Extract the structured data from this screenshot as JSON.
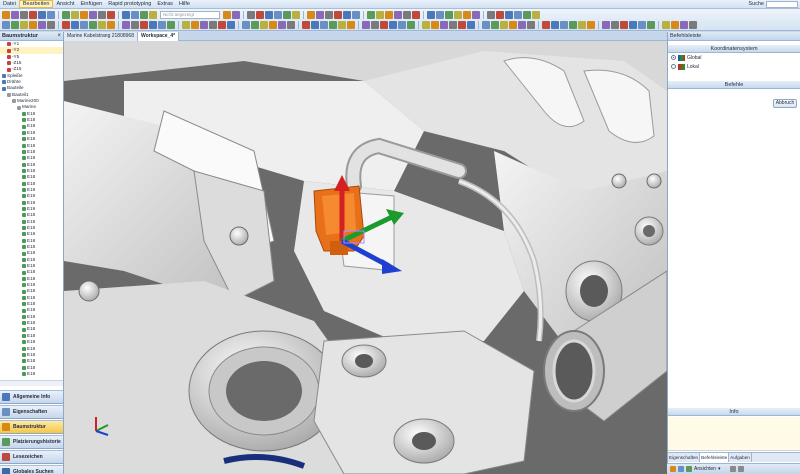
{
  "menu": {
    "items": [
      "Datei",
      "Bearbeiten",
      "Ansicht",
      "Einfügen",
      "Rapid prototyping",
      "Extras",
      "Hilfe"
    ],
    "active_index": 1,
    "search_label": "Suche"
  },
  "toolbar": {
    "search_placeholder": "Nicht angezeigt"
  },
  "left_panel": {
    "title": "Baumstruktur",
    "close": "×",
    "tree": [
      {
        "indent": 1,
        "label": "-Y1",
        "icon": "red"
      },
      {
        "indent": 1,
        "label": "-Y2",
        "icon": "red",
        "selected": true
      },
      {
        "indent": 1,
        "label": "-Y5",
        "icon": "red"
      },
      {
        "indent": 1,
        "label": "-Z15",
        "icon": "red"
      },
      {
        "indent": 1,
        "label": "-Z15",
        "icon": "red"
      },
      {
        "indent": 0,
        "label": "Spleiße",
        "icon": "blue"
      },
      {
        "indent": 0,
        "label": "Drähte",
        "icon": "blue"
      },
      {
        "indent": 0,
        "label": "Bauteile",
        "icon": "blue"
      },
      {
        "indent": 1,
        "label": "Bauteil1",
        "icon": "gray"
      },
      {
        "indent": 2,
        "label": "Marine200",
        "icon": "gray"
      },
      {
        "indent": 3,
        "label": "Marine",
        "icon": "gray"
      },
      {
        "indent": 4,
        "label": "E18",
        "icon": "green"
      },
      {
        "indent": 4,
        "label": "E18",
        "icon": "green"
      },
      {
        "indent": 4,
        "label": "E18",
        "icon": "green"
      },
      {
        "indent": 4,
        "label": "E18",
        "icon": "green"
      },
      {
        "indent": 4,
        "label": "E18",
        "icon": "green"
      },
      {
        "indent": 4,
        "label": "E18",
        "icon": "green"
      },
      {
        "indent": 4,
        "label": "E18",
        "icon": "green"
      },
      {
        "indent": 4,
        "label": "E18",
        "icon": "green"
      },
      {
        "indent": 4,
        "label": "E18",
        "icon": "green"
      },
      {
        "indent": 4,
        "label": "E18",
        "icon": "green"
      },
      {
        "indent": 4,
        "label": "E18",
        "icon": "green"
      },
      {
        "indent": 4,
        "label": "E18",
        "icon": "green"
      },
      {
        "indent": 4,
        "label": "E19",
        "icon": "green"
      },
      {
        "indent": 4,
        "label": "E19",
        "icon": "green"
      },
      {
        "indent": 4,
        "label": "E19",
        "icon": "green"
      },
      {
        "indent": 4,
        "label": "E19",
        "icon": "green"
      },
      {
        "indent": 4,
        "label": "E18",
        "icon": "green"
      },
      {
        "indent": 4,
        "label": "E18",
        "icon": "green"
      },
      {
        "indent": 4,
        "label": "E18",
        "icon": "green"
      },
      {
        "indent": 4,
        "label": "E18",
        "icon": "green"
      },
      {
        "indent": 4,
        "label": "E18",
        "icon": "green"
      },
      {
        "indent": 4,
        "label": "E18",
        "icon": "green"
      },
      {
        "indent": 4,
        "label": "E18",
        "icon": "green"
      },
      {
        "indent": 4,
        "label": "E18",
        "icon": "green"
      },
      {
        "indent": 4,
        "label": "E18",
        "icon": "green"
      },
      {
        "indent": 4,
        "label": "E18",
        "icon": "green"
      },
      {
        "indent": 4,
        "label": "E18",
        "icon": "green"
      },
      {
        "indent": 4,
        "label": "E18",
        "icon": "green"
      },
      {
        "indent": 4,
        "label": "E18",
        "icon": "green"
      },
      {
        "indent": 4,
        "label": "E18",
        "icon": "green"
      },
      {
        "indent": 4,
        "label": "E18",
        "icon": "green"
      },
      {
        "indent": 4,
        "label": "E18",
        "icon": "green"
      },
      {
        "indent": 4,
        "label": "E18",
        "icon": "green"
      },
      {
        "indent": 4,
        "label": "E18",
        "icon": "green"
      },
      {
        "indent": 4,
        "label": "E18",
        "icon": "green"
      },
      {
        "indent": 4,
        "label": "E18",
        "icon": "green"
      },
      {
        "indent": 4,
        "label": "E18",
        "icon": "green"
      },
      {
        "indent": 4,
        "label": "E18",
        "icon": "green"
      },
      {
        "indent": 4,
        "label": "E18",
        "icon": "green"
      },
      {
        "indent": 4,
        "label": "E18",
        "icon": "green"
      },
      {
        "indent": 4,
        "label": "E18",
        "icon": "green"
      },
      {
        "indent": 4,
        "label": "E18",
        "icon": "green"
      }
    ],
    "nav": [
      {
        "label": "Allgemeine Info",
        "icon_color": "#4a78b8",
        "active": false
      },
      {
        "label": "Eigenschaften",
        "icon_color": "#6a8fc2",
        "active": false
      },
      {
        "label": "Baumstruktur",
        "icon_color": "#d88a18",
        "active": true
      },
      {
        "label": "Platzierungshistorie",
        "icon_color": "#5a9a5a",
        "active": false
      },
      {
        "label": "Lesezeichen",
        "icon_color": "#c04a3a",
        "active": false
      },
      {
        "label": "Globales Suchen",
        "icon_color": "#3a6aa8",
        "active": false
      }
    ]
  },
  "doc_tabs": [
    {
      "label": "Marine Kabelstrang 21808968",
      "active": false
    },
    {
      "label": "Workspace_4*",
      "active": true
    }
  ],
  "right_panel": {
    "title": "Befehlsleiste",
    "coord_header": "Koordinatensystem",
    "options": [
      {
        "label": "Global",
        "checked": true
      },
      {
        "label": "Lokal",
        "checked": false
      }
    ],
    "commands_header": "Befehle",
    "abort_label": "Abbruch",
    "info_header": "Info",
    "tabs": [
      {
        "label": "Eigenschaften",
        "active": false
      },
      {
        "label": "Befehlsleiste",
        "active": true
      },
      {
        "label": "Aufgaben",
        "active": false
      }
    ]
  },
  "statusbar": {
    "view_label": "Ansichten"
  },
  "colors": {
    "gizmo_x": "#1f3fd0",
    "gizmo_y": "#1c9a2c",
    "gizmo_z": "#d42020",
    "connector": "#e8701a",
    "accent": "#f6c548"
  }
}
